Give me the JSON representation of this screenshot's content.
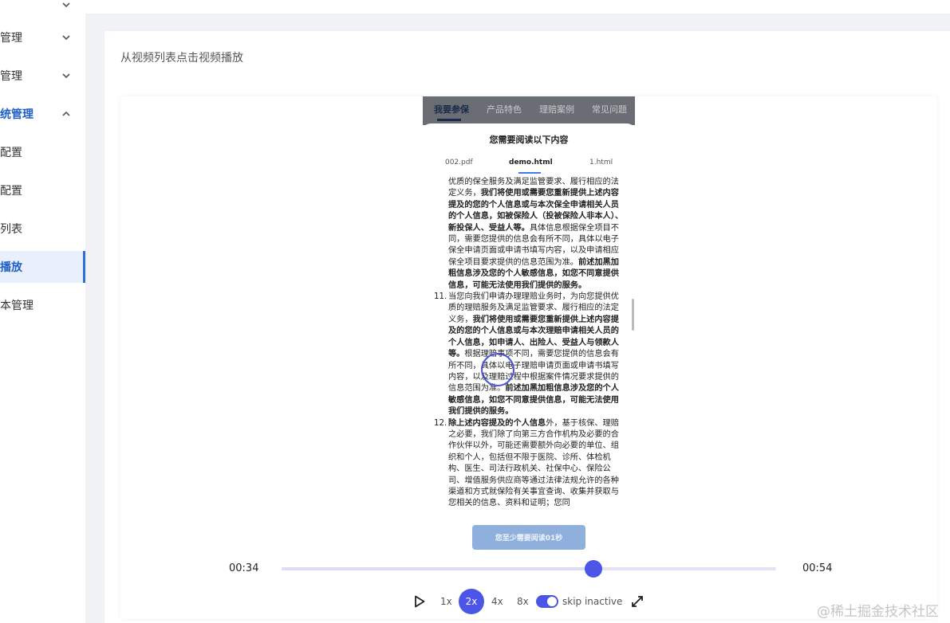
{
  "sidebar": {
    "items": [
      {
        "label": "管理"
      },
      {
        "label": "管理"
      },
      {
        "label": "统管理"
      },
      {
        "label": "配置"
      },
      {
        "label": "配置"
      },
      {
        "label": "列表"
      },
      {
        "label": "播放"
      },
      {
        "label": "本管理"
      }
    ]
  },
  "card": {
    "title": "从视频列表点击视频播放"
  },
  "phone": {
    "nav": [
      "我要参保",
      "产品特色",
      "理赔案例",
      "常见问题"
    ],
    "sheet_title": "您需要阅读以下内容",
    "doc_tabs": [
      "002.pdf",
      "demo.html",
      "1.html"
    ],
    "para10_l1": "优质的保全服务及满足监管要求、履行相应的",
    "para10_l2": "法定义务，",
    "para10_b1": "我们将使用或需要您重新提供上述内容提及的您的个人信息或与本次保全申请相关人员的个人信息，如被保险人（投被保险人非本人）、新投保人、受益人等。",
    "para10_t2": "具体信息根据保全项目不同，需要您提供的信息会有所不同，具体以电子保全申请页面或申请书填写内容，以及申请相应保全项目要求提供的信息范围为准。",
    "para10_b2": "前述加黑加粗信息涉及您的个人敏感信息，如您不同意提供信息，可能无法使用我们提供的服务。",
    "para11_num": "11.",
    "para11_t1": "当您向我们申请办理理赔业务时，为向您提供优质的理赔服务及满足监管要求、履行相应的法定义务，",
    "para11_b1": "我们将使用或需要您重新提供上述内容提及的您的个人信息或与本次理赔申请相关人员的个人信息，如申请人、出险人、受益人与领款人等。",
    "para11_t2": "根据理赔事项不同，需要您提供的信息会有所不同，具体以电子理赔申请页面或申请书填写内容，以及理赔过程中根据案件情况要求提供的信息范围为准。",
    "para11_b2": "前述加黑加粗信息涉及您的个人敏感信息，如您不同意提供信息，可能无法使用我们提供的服务。",
    "para12_num": "12.",
    "para12_b1": "除上述内容提及的个人信息",
    "para12_t1": "外，基于核保、理赔之必要，我们除了向第三方合作机构及必要的合作伙伴以外，可能还需要额外向必要的单位、组织和个人，包括但不限于医院、诊所、体检机构、医生、司法行政机关、社保中心、保险公司、增值服务供应商等通过法律法规允许的各种渠道和方式就保险有关事宜查询、收集并获取与您相关的信息、资料和证明；您同",
    "read_button": "您至少需要阅读01秒"
  },
  "player": {
    "current_time": "00:34",
    "total_time": "00:54",
    "progress": 0.63,
    "speeds": [
      "1x",
      "2x",
      "4x",
      "8x"
    ],
    "active_speed": "2x",
    "skip_inactive": "skip inactive",
    "skip_inactive_on": true
  },
  "watermark": "@稀土掘金技术社区",
  "colors": {
    "accent": "#4b55e8",
    "sidebar_active": "#1f5fc6"
  }
}
